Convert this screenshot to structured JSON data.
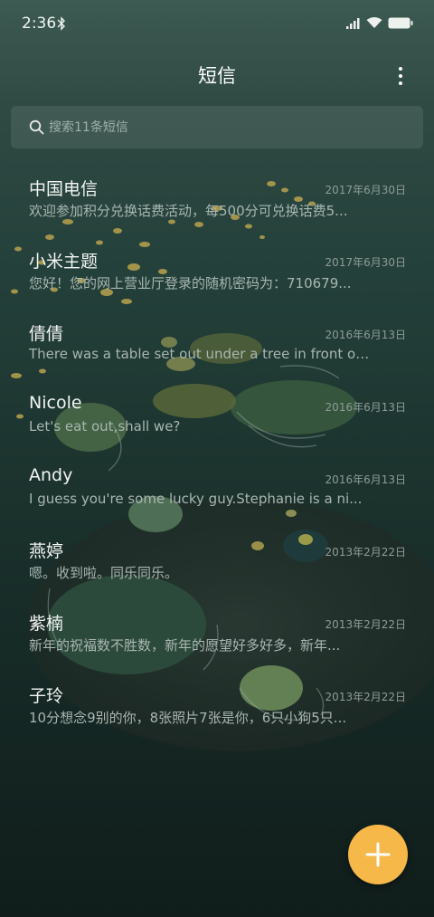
{
  "status_bar": {
    "time": "2:36",
    "icons": [
      "bluetooth-icon",
      "signal-icon",
      "wifi-icon",
      "battery-icon"
    ]
  },
  "header": {
    "title": "短信",
    "menu_icon": "more-vertical-icon"
  },
  "search": {
    "placeholder": "搜索11条短信",
    "value": "",
    "icon": "search-icon"
  },
  "conversations": [
    {
      "name": "中国电信",
      "date": "2017年6月30日",
      "preview": "欢迎参加积分兑换话费活动，每500分可兑换话费5..."
    },
    {
      "name": "小米主题",
      "date": "2017年6月30日",
      "preview": "您好！您的网上营业厅登录的随机密码为：710679..."
    },
    {
      "name": "倩倩",
      "date": "2016年6月13日",
      "preview": "There was a table set out under a tree in front of ..."
    },
    {
      "name": "Nicole",
      "date": "2016年6月13日",
      "preview": "Let's eat out,shall we?"
    },
    {
      "name": "Andy",
      "date": "2016年6月13日",
      "preview": "I guess you're some lucky guy.Stephanie is a ni..."
    },
    {
      "name": "燕婷",
      "date": "2013年2月22日",
      "preview": "嗯。收到啦。同乐同乐。"
    },
    {
      "name": "紫楠",
      "date": "2013年2月22日",
      "preview": "新年的祝福数不胜数，新年的愿望好多好多，新年..."
    },
    {
      "name": "子玲",
      "date": "2013年2月22日",
      "preview": "10分想念9别的你，8张照片7张是你，6只小狗5只..."
    }
  ],
  "fab": {
    "icon": "plus-icon",
    "color": "#f7b84a"
  },
  "colors": {
    "background_top": "#3d5a52",
    "background_bottom": "#101d1b",
    "accent": "#f7b84a"
  }
}
